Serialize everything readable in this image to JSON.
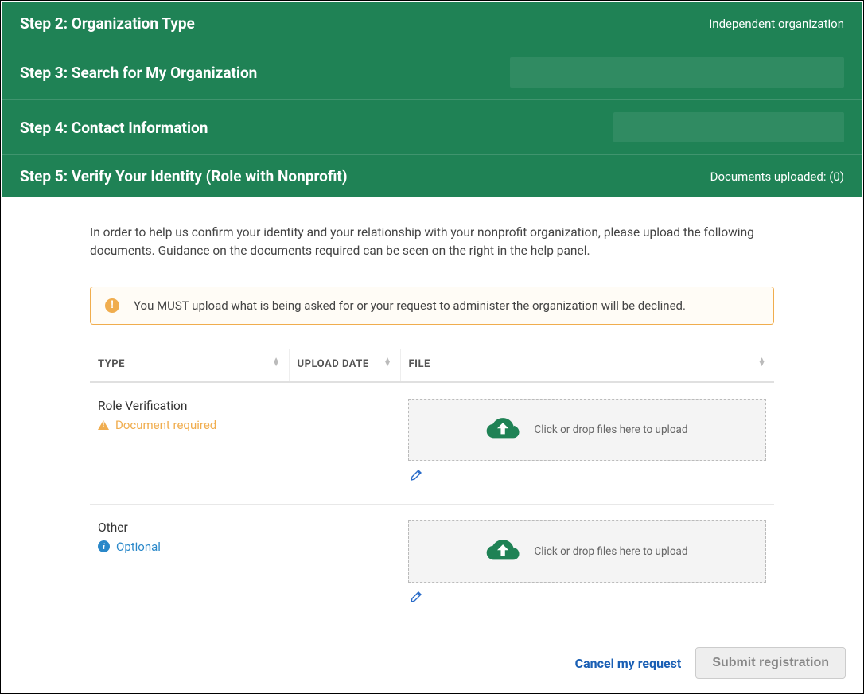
{
  "steps": {
    "step2": {
      "title": "Step 2: Organization Type",
      "summary": "Independent organization"
    },
    "step3": {
      "title": "Step 3: Search for My Organization"
    },
    "step4": {
      "title": "Step 4: Contact Information"
    },
    "step5": {
      "title": "Step 5: Verify Your Identity (Role with Nonprofit)",
      "summary": "Documents uploaded: (0)"
    }
  },
  "content": {
    "intro": "In order to help us confirm your identity and your relationship with your nonprofit organization, please upload the following documents. Guidance on the documents required can be seen on the right in the help panel.",
    "warning": "You MUST upload what is being asked for or your request to administer the organization will be declined."
  },
  "table": {
    "headers": {
      "type": "TYPE",
      "date": "UPLOAD DATE",
      "file": "FILE"
    },
    "dropzone_text": "Click or drop files here to upload",
    "rows": [
      {
        "type": "Role Verification",
        "badge": "Document required",
        "badge_kind": "required"
      },
      {
        "type": "Other",
        "badge": "Optional",
        "badge_kind": "optional"
      }
    ]
  },
  "footer": {
    "cancel": "Cancel my request",
    "submit": "Submit registration"
  },
  "icons": {
    "cloud_upload": "cloud-upload-icon",
    "edit": "pencil-icon",
    "warning_triangle": "warning-triangle-icon",
    "info": "info-icon",
    "alert": "alert-icon"
  }
}
